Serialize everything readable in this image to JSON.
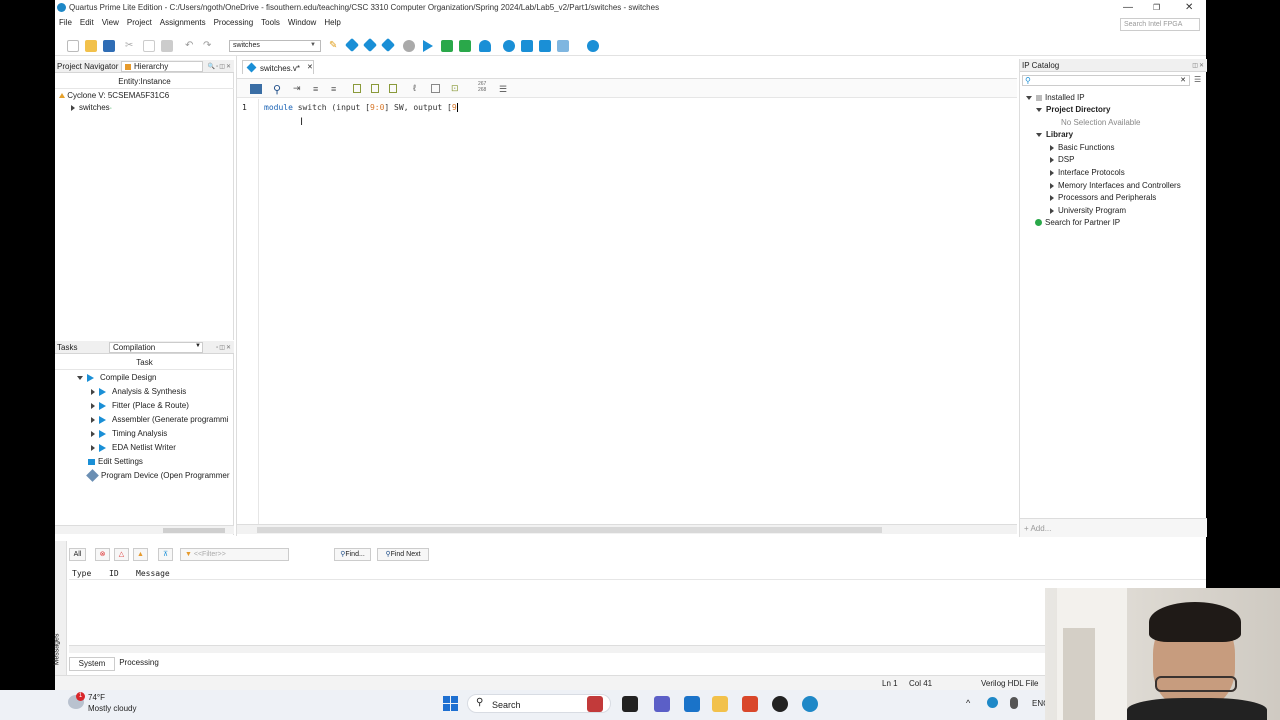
{
  "window": {
    "title": "Quartus Prime Lite Edition - C:/Users/ngoth/OneDrive - fisouthern.edu/teaching/CSC 3310 Computer Organization/Spring 2024/Lab/Lab5_v2/Part1/switches - switches",
    "search_placeholder": "Search Intel FPGA"
  },
  "menu": [
    "File",
    "Edit",
    "View",
    "Project",
    "Assignments",
    "Processing",
    "Tools",
    "Window",
    "Help"
  ],
  "toolbar": {
    "revision": "switches"
  },
  "project_navigator": {
    "title": "Project Navigator",
    "view": "Hierarchy",
    "column": "Entity:Instance",
    "device": "Cyclone V: 5CSEMA5F31C6",
    "entity": "switches"
  },
  "tasks": {
    "title": "Tasks",
    "flow": "Compilation",
    "column": "Task",
    "items": [
      {
        "label": "Compile Design"
      },
      {
        "label": "Analysis & Synthesis"
      },
      {
        "label": "Fitter (Place & Route)"
      },
      {
        "label": "Assembler (Generate programmi"
      },
      {
        "label": "Timing Analysis"
      },
      {
        "label": "EDA Netlist Writer"
      },
      {
        "label": "Edit Settings"
      },
      {
        "label": "Program Device (Open Programmer"
      }
    ]
  },
  "editor": {
    "tab": "switches.v*",
    "line_number": "1",
    "code_kw": "module",
    "code_a": " switch (input [",
    "code_n1": "9:0",
    "code_b": "] SW, output [",
    "code_n2": "9",
    "counter_top": "267",
    "counter_bot": "268"
  },
  "ip_catalog": {
    "title": "IP Catalog",
    "installed": "Installed IP",
    "project_dir": "Project Directory",
    "no_selection": "No Selection Available",
    "library": "Library",
    "items": [
      "Basic Functions",
      "DSP",
      "Interface Protocols",
      "Memory Interfaces and Controllers",
      "Processors and Peripherals",
      "University Program"
    ],
    "partner": "Search for Partner IP",
    "add": "+ Add..."
  },
  "messages": {
    "all": "All",
    "filter": "<<Filter>>",
    "find": "Find...",
    "find_next": "Find Next",
    "cols": [
      "Type",
      "ID",
      "Message"
    ],
    "tabs": [
      "System",
      "Processing"
    ],
    "side_label": "Messages"
  },
  "status": {
    "ln": "Ln 1",
    "col": "Col 41",
    "file_type": "Verilog HDL File"
  },
  "taskbar": {
    "weather_temp": "74°F",
    "weather_desc": "Mostly cloudy",
    "search": "Search",
    "lang": "ENG",
    "badge": "1"
  }
}
